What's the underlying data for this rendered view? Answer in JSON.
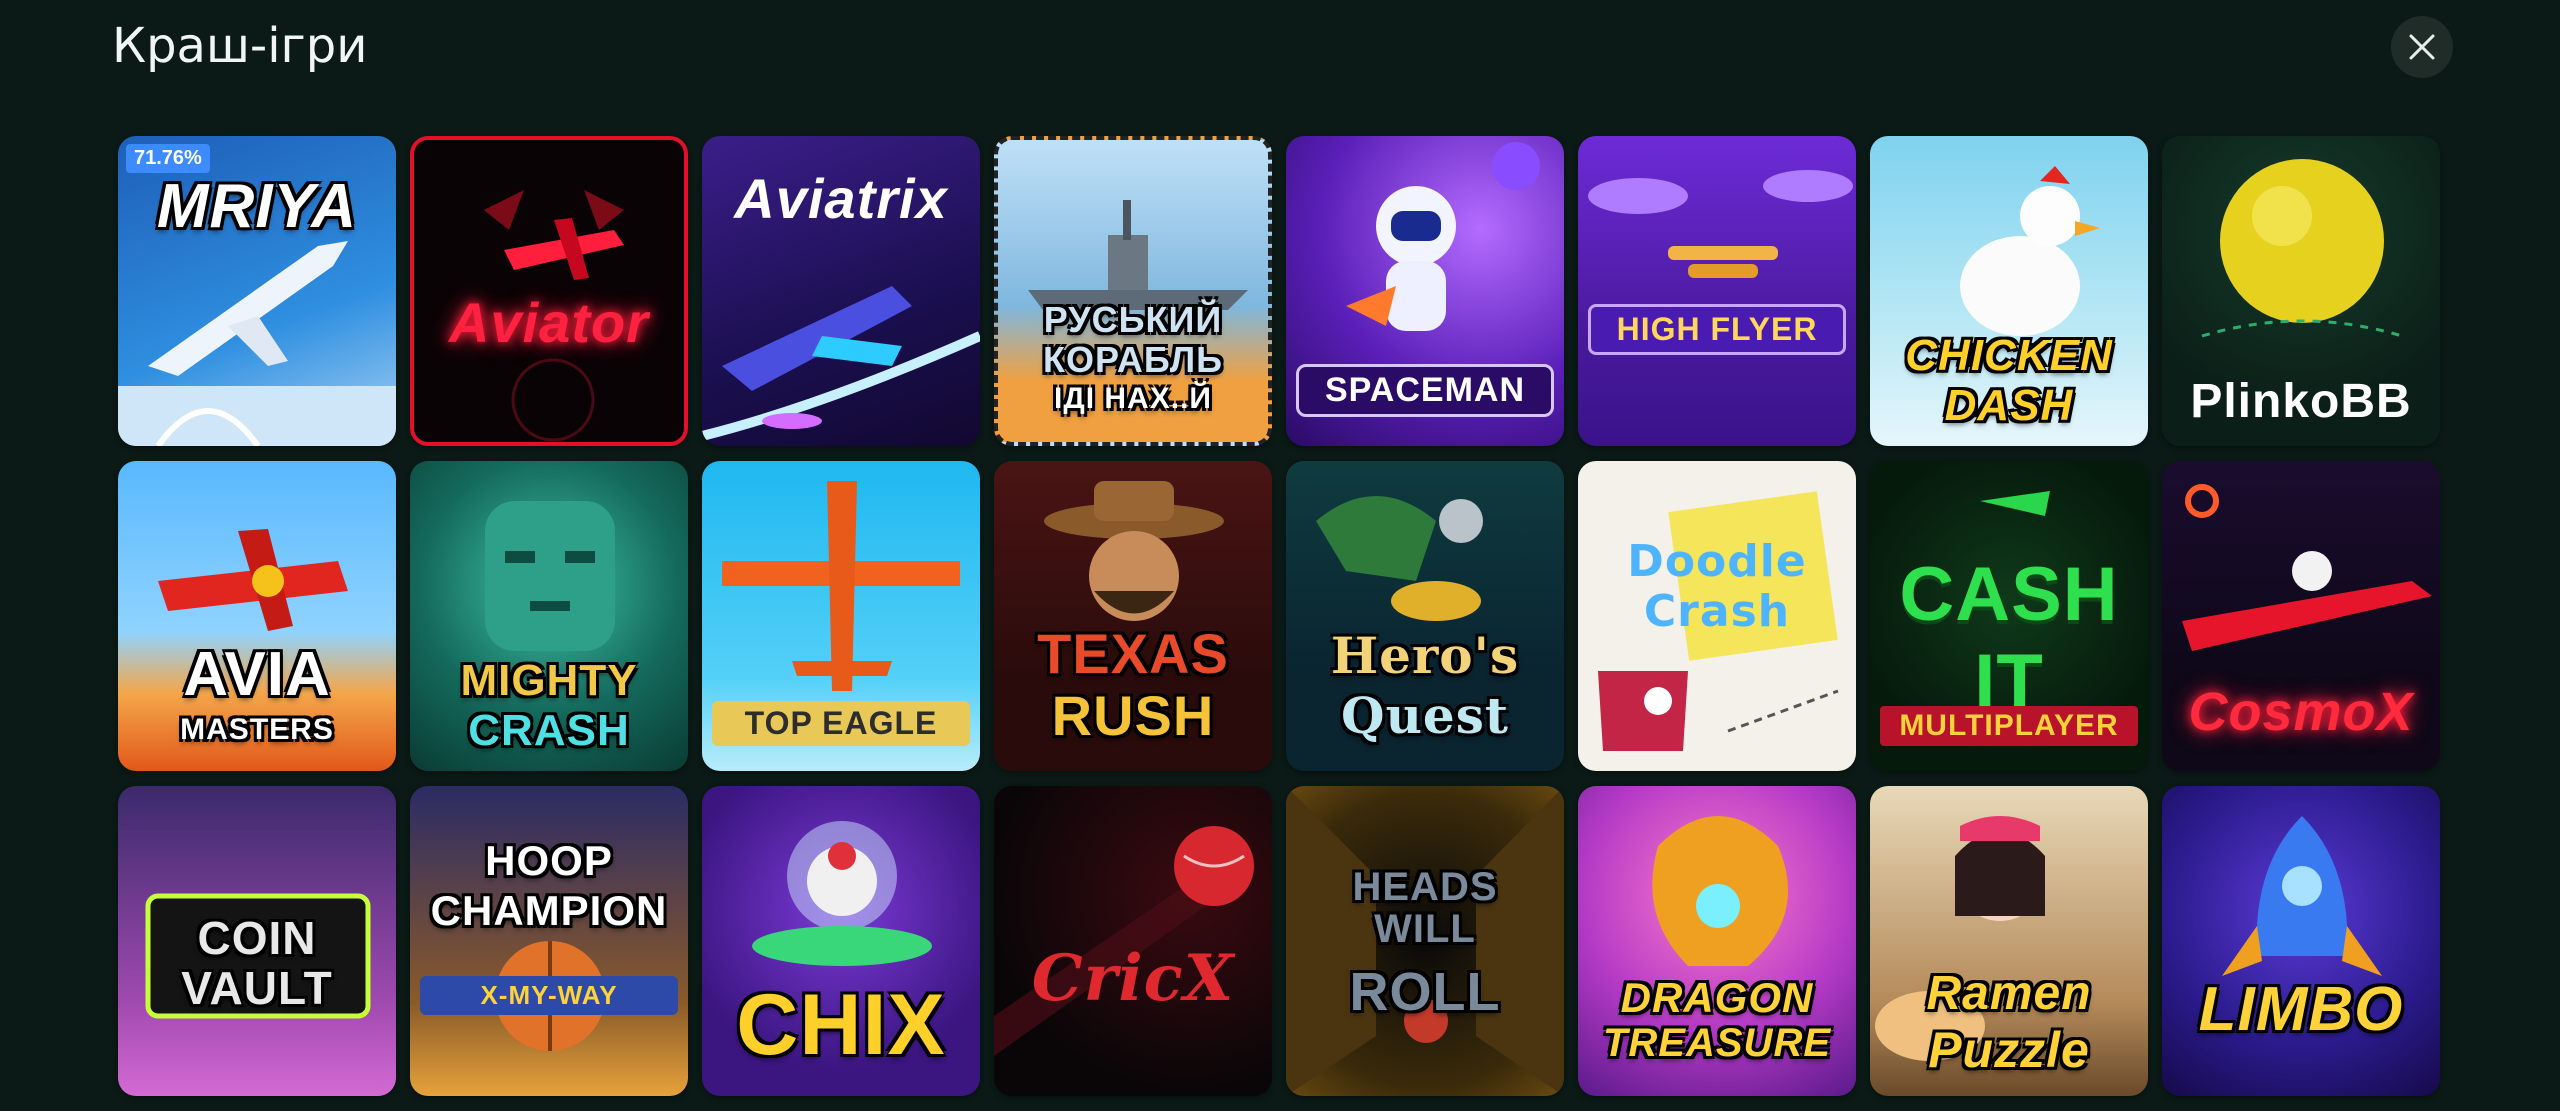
{
  "header": {
    "title": "Краш-ігри"
  },
  "games": [
    {
      "name": "MRIYA",
      "badge": "71.76%"
    },
    {
      "name": "Aviator"
    },
    {
      "name": "Aviatrix"
    },
    {
      "name": "РУСЬКИЙ КОРАБЛЬ",
      "sub": "ІДІ НАХ..Й"
    },
    {
      "name": "SPACEMAN"
    },
    {
      "name": "HIGH FLYER"
    },
    {
      "name": "CHICKEN DASH"
    },
    {
      "name": "PlinkoBB"
    },
    {
      "name": "AVIA",
      "sub": "MASTERS"
    },
    {
      "name": "MIGHTY",
      "sub": "CRASH"
    },
    {
      "name": "TOP EAGLE"
    },
    {
      "name": "TEXAS",
      "sub": "RUSH"
    },
    {
      "name": "Hero's",
      "sub": "Quest"
    },
    {
      "name": "Doodle",
      "sub": "Crash"
    },
    {
      "name": "CASH IT",
      "sub": "MULTIPLAYER"
    },
    {
      "name": "CosmoX"
    },
    {
      "name": "COIN",
      "sub": "VAULT"
    },
    {
      "name": "HOOP CHAMPION",
      "sub": "X-MY-WAY"
    },
    {
      "name": "CHIX"
    },
    {
      "name": "CricX"
    },
    {
      "name": "HEADS WILL",
      "sub": "ROLL"
    },
    {
      "name": "DRAGON",
      "sub": "TREASURE"
    },
    {
      "name": "Ramen",
      "sub": "Puzzle"
    },
    {
      "name": "LIMBO"
    }
  ]
}
